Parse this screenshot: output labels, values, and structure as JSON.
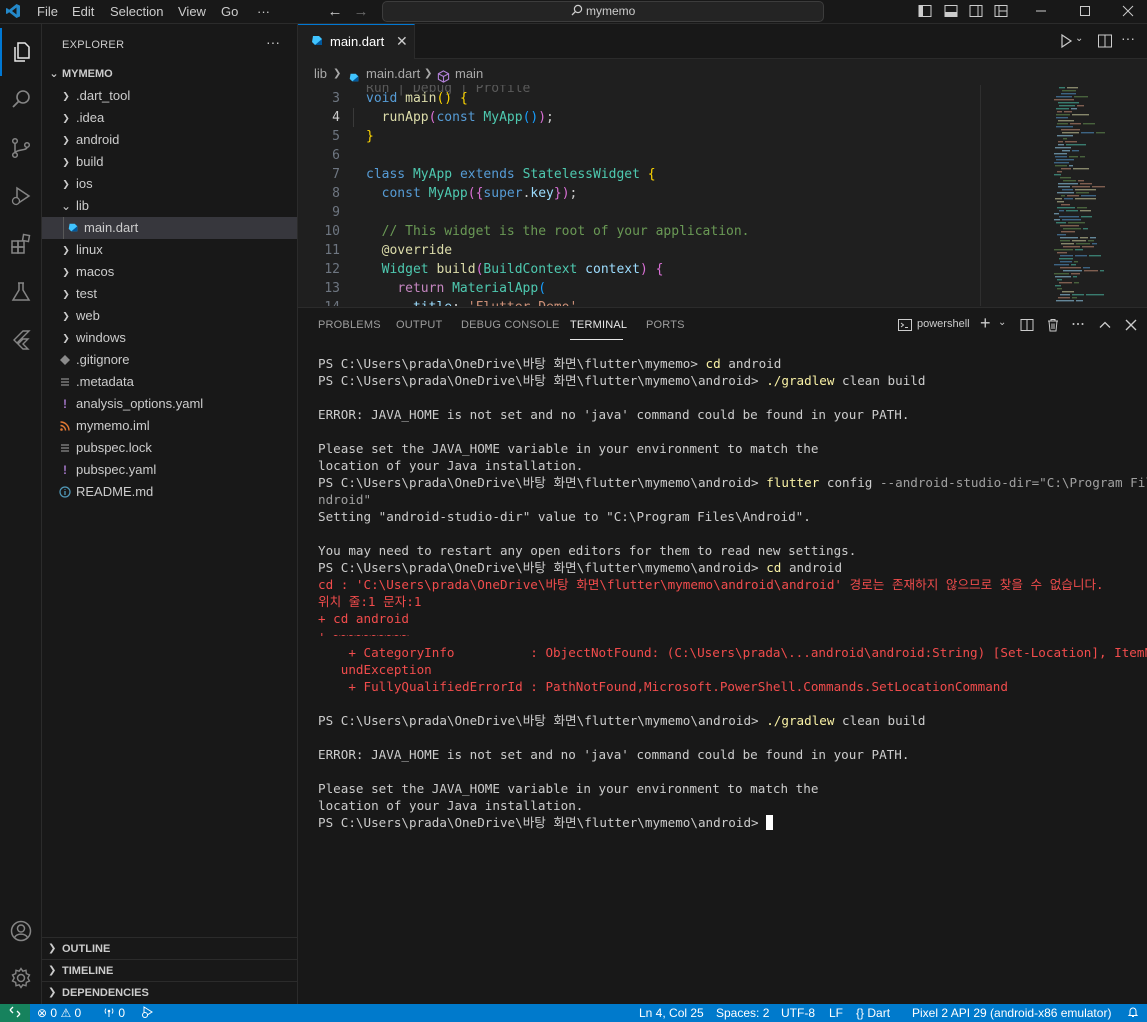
{
  "titlebar": {
    "menus": [
      "File",
      "Edit",
      "Selection",
      "View",
      "Go",
      "···"
    ],
    "search": "mymemo"
  },
  "explorer": {
    "title": "EXPLORER",
    "more": "···",
    "root": "MYMEMO",
    "items": [
      {
        "label": ".dart_tool",
        "kind": "folder",
        "expanded": false
      },
      {
        "label": ".idea",
        "kind": "folder",
        "expanded": false
      },
      {
        "label": "android",
        "kind": "folder",
        "expanded": false
      },
      {
        "label": "build",
        "kind": "folder",
        "expanded": false
      },
      {
        "label": "ios",
        "kind": "folder",
        "expanded": false
      },
      {
        "label": "lib",
        "kind": "folder",
        "expanded": true
      },
      {
        "label": "main.dart",
        "kind": "dart-file",
        "selected": true
      },
      {
        "label": "linux",
        "kind": "folder",
        "expanded": false
      },
      {
        "label": "macos",
        "kind": "folder",
        "expanded": false
      },
      {
        "label": "test",
        "kind": "folder",
        "expanded": false
      },
      {
        "label": "web",
        "kind": "folder",
        "expanded": false
      },
      {
        "label": "windows",
        "kind": "folder",
        "expanded": false
      },
      {
        "label": ".gitignore",
        "kind": "git-file"
      },
      {
        "label": ".metadata",
        "kind": "list-file"
      },
      {
        "label": "analysis_options.yaml",
        "kind": "yaml-file"
      },
      {
        "label": "mymemo.iml",
        "kind": "rss-file"
      },
      {
        "label": "pubspec.lock",
        "kind": "list-file"
      },
      {
        "label": "pubspec.yaml",
        "kind": "yaml-file"
      },
      {
        "label": "README.md",
        "kind": "info-file"
      }
    ],
    "sections": [
      "OUTLINE",
      "TIMELINE",
      "DEPENDENCIES"
    ]
  },
  "editor": {
    "tab": "main.dart",
    "breadcrumb": [
      "lib",
      "main.dart",
      "main"
    ],
    "line_numbers": [
      "3",
      "4",
      "5",
      "6",
      "7",
      "8",
      "9",
      "10",
      "11",
      "12",
      "13",
      "14"
    ],
    "current_line": "4"
  },
  "panel": {
    "tabs": [
      "PROBLEMS",
      "OUTPUT",
      "DEBUG CONSOLE",
      "TERMINAL",
      "PORTS"
    ],
    "active_tab": "TERMINAL",
    "shell": "powershell",
    "terminal": {
      "prompt_android": "PS C:\\Users\\prada\\OneDrive\\바탕 화면\\flutter\\mymemo\\android> ",
      "prompt_root": "PS C:\\Users\\prada\\OneDrive\\바탕 화면\\flutter\\mymemo> ",
      "l1_cmd": "cd",
      "l1_arg": " android",
      "l2_cmd": "./gradlew",
      "l2_arg": " clean build",
      "err_java": "ERROR: JAVA_HOME is not set and no 'java' command could be found in your PATH.",
      "please1": "Please set the JAVA_HOME variable in your environment to match the",
      "please2": "location of your Java installation.",
      "flutter_cmd": "flutter",
      "flutter_arg": " config",
      "flutter_opt": " --android-studio-dir=\"C:\\Program Files\\A",
      "flutter_wrap": "ndroid\"",
      "setting": "Setting \"android-studio-dir\" value to \"C:\\Program Files\\Android\".",
      "restart": "You may need to restart any open editors for them to read new settings.",
      "cd_err": "cd : 'C:\\Users\\prada\\OneDrive\\바탕 화면\\flutter\\mymemo\\android\\android' 경로는 존재하지 않으므로 찾을 수 없습니다.",
      "pos": "위치 줄:1 문자:1",
      "plus_cd": "+ cd android",
      "tilde": "+ ~~~~~~~~~~",
      "cat_info": "    + CategoryInfo          : ObjectNotFound: (C:\\Users\\prada\\...android\\android:String) [Set-Location], ItemNotFo",
      "cat_wrap": "   undException",
      "fq_err": "    + FullyQualifiedErrorId : PathNotFound,Microsoft.PowerShell.Commands.SetLocationCommand"
    }
  },
  "statusbar": {
    "errors": "0",
    "warnings": "0",
    "ports": "0",
    "position": "Ln 4, Col 25",
    "spaces": "Spaces: 2",
    "encoding": "UTF-8",
    "eol": "LF",
    "language": "Dart",
    "device": "Pixel 2 API 29 (android-x86 emulator)"
  },
  "colors": {
    "accent": "#0078d4",
    "statusbar": "#007acc",
    "remote": "#16825d",
    "terminal_error": "#f14c4c",
    "terminal_command": "#f9f1a5"
  }
}
